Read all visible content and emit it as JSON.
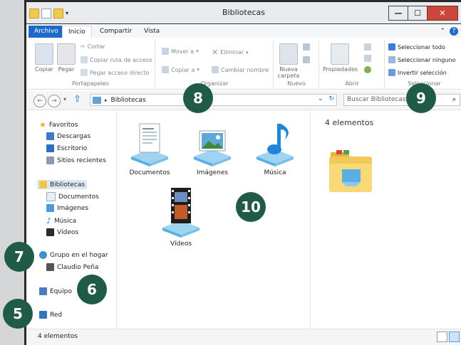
{
  "window": {
    "title": "Bibliotecas"
  },
  "tabs": [
    {
      "label": "Archivo"
    },
    {
      "label": "Inicio"
    },
    {
      "label": "Compartir"
    },
    {
      "label": "Vista"
    }
  ],
  "ribbon": {
    "portapapeles": {
      "label": "Portapapeles",
      "copiar": "Copiar",
      "pegar": "Pegar",
      "cortar": "Cortar",
      "copiar_ruta": "Copiar ruta de acceso",
      "pegar_directo": "Pegar acceso directo"
    },
    "organizar": {
      "label": "Organizar",
      "mover": "Mover a",
      "copiar": "Copiar a",
      "eliminar": "Eliminar",
      "cambiar_nombre": "Cambiar nombre"
    },
    "nuevo": {
      "label": "Nuevo",
      "nueva_carpeta": "Nueva carpeta"
    },
    "abrir": {
      "label": "Abrir",
      "propiedades": "Propiedades"
    },
    "seleccionar": {
      "label": "Seleccionar",
      "todo": "Seleccionar todo",
      "ninguno": "Seleccionar ninguno",
      "invertir": "Invertir selección"
    }
  },
  "address": {
    "path": "Bibliotecas"
  },
  "search": {
    "placeholder": "Buscar Bibliotecas"
  },
  "sidebar": {
    "favoritos": "Favoritos",
    "descargas": "Descargas",
    "escritorio": "Escritorio",
    "sitios": "Sitios recientes",
    "bibliotecas": "Bibliotecas",
    "documentos": "Documentos",
    "imagenes": "Imágenes",
    "musica": "Música",
    "videos": "Vídeos",
    "grupo": "Grupo en el hogar",
    "usuario": "Claudio Peña",
    "equipo": "Equipo",
    "red": "Red"
  },
  "content": {
    "items": [
      {
        "label": "Documentos"
      },
      {
        "label": "Imágenes"
      },
      {
        "label": "Música"
      },
      {
        "label": "Vídeos"
      }
    ]
  },
  "preview": {
    "count": "4 elementos"
  },
  "status": {
    "text": "4 elementos"
  },
  "callouts": [
    "8",
    "9",
    "10",
    "7",
    "6",
    "5"
  ],
  "colors": {
    "accent": "#1b6ac9",
    "callout": "#1f5b45",
    "close": "#c9473b"
  }
}
